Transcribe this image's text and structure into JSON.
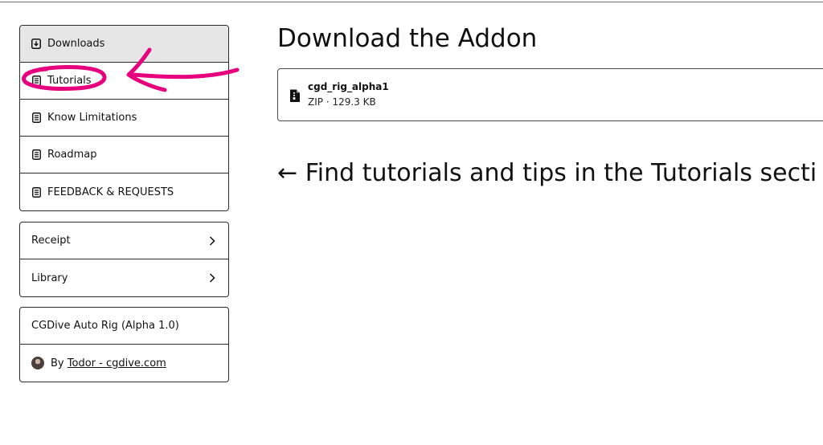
{
  "sidebar": {
    "nav": [
      {
        "label": "Downloads",
        "icon": "download-box-icon",
        "active": true
      },
      {
        "label": "Tutorials",
        "icon": "document-icon",
        "active": false
      },
      {
        "label": "Know Limitations",
        "icon": "document-icon",
        "active": false
      },
      {
        "label": "Roadmap",
        "icon": "document-icon",
        "active": false
      },
      {
        "label": "FEEDBACK & REQUESTS",
        "icon": "document-icon",
        "active": false
      }
    ],
    "links": [
      {
        "label": "Receipt",
        "icon": "chevron-right-icon"
      },
      {
        "label": "Library",
        "icon": "chevron-right-icon"
      }
    ],
    "product": {
      "name": "CGDive Auto Rig (Alpha 1.0)",
      "by_prefix": "By",
      "author": "Todor - cgdive.com"
    }
  },
  "main": {
    "title": "Download the Addon",
    "file": {
      "name": "cgd_rig_alpha1",
      "type": "ZIP",
      "separator": "·",
      "size": "129.3 KB",
      "icon": "zip-file-icon"
    },
    "tip": {
      "arrow": "←",
      "text": "Find tutorials and tips in the Tutorials secti"
    }
  },
  "annotation": {
    "color": "#e6007e"
  }
}
